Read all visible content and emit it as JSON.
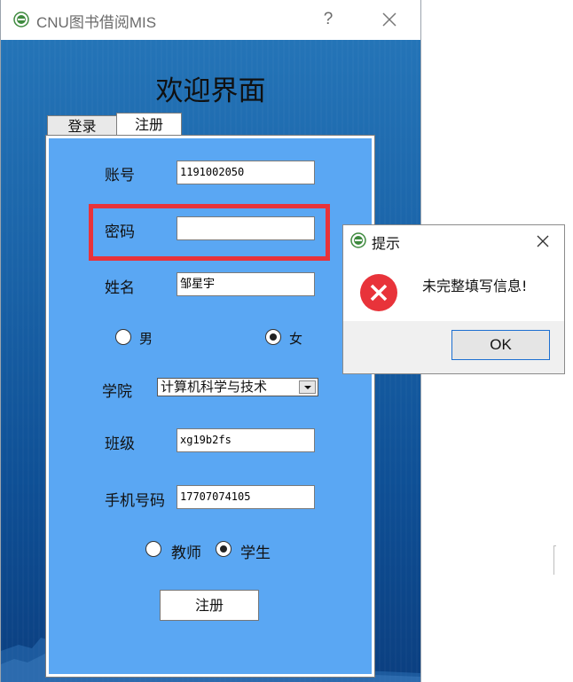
{
  "window": {
    "title": "CNU图书借阅MIS",
    "help": "?"
  },
  "welcome": "欢迎界面",
  "tabs": [
    {
      "label": "登录"
    },
    {
      "label": "注册"
    }
  ],
  "form": {
    "account_label": "账号",
    "account_value": "1191002050",
    "password_label": "密码",
    "password_value": "",
    "name_label": "姓名",
    "name_value": "邹星宇",
    "gender_options": [
      {
        "label": "男",
        "checked": false
      },
      {
        "label": "女",
        "checked": true
      }
    ],
    "college_label": "学院",
    "college_value": "计算机科学与技术",
    "class_label": "班级",
    "class_value": "xg19b2fs",
    "phone_label": "手机号码",
    "phone_value": "17707074105",
    "role_options": [
      {
        "label": "教师",
        "checked": false
      },
      {
        "label": "学生",
        "checked": true
      }
    ],
    "register_button": "注册"
  },
  "dialog": {
    "title": "提示",
    "message": "未完整填写信息!",
    "ok": "OK"
  },
  "colors": {
    "form_bg": "#5aa7f3",
    "highlight": "#e8333a",
    "error": "#e8333a",
    "background_top": "#2474b7"
  }
}
